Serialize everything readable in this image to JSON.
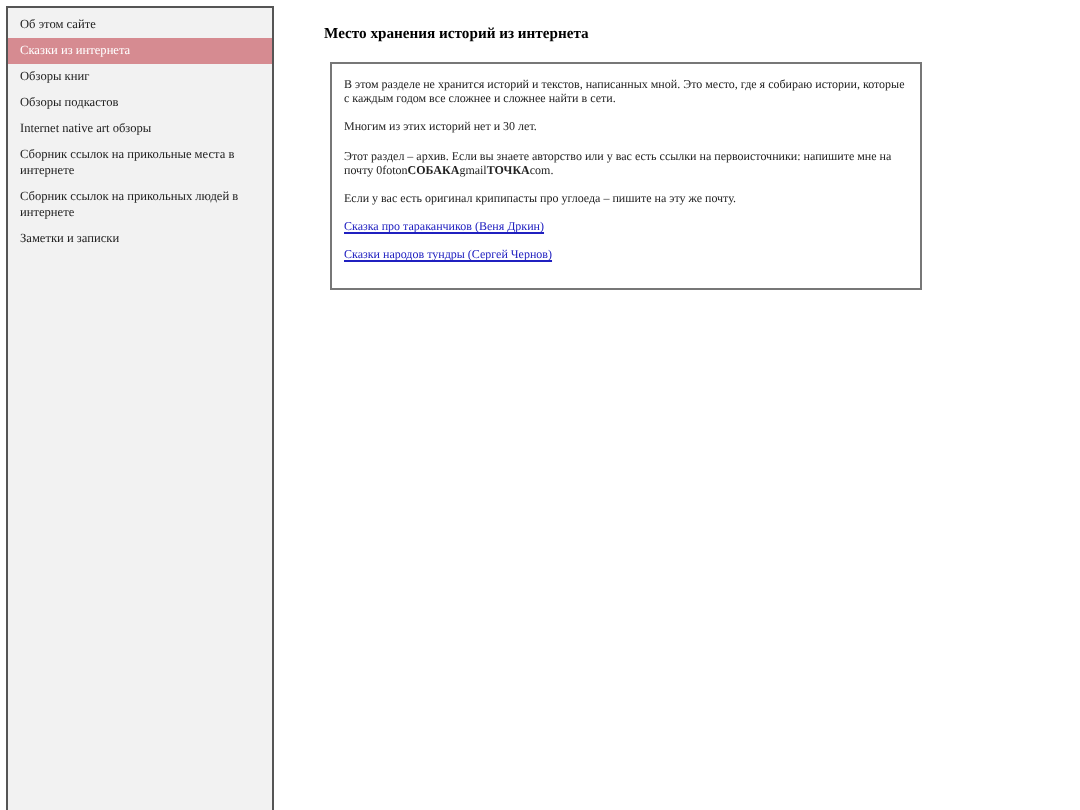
{
  "sidebar": {
    "items": [
      {
        "label": "Об этом сайте",
        "selected": false
      },
      {
        "label": "Сказки из интернета",
        "selected": true
      },
      {
        "label": "Обзоры книг",
        "selected": false
      },
      {
        "label": "Обзоры подкастов",
        "selected": false
      },
      {
        "label": "Internet native art обзоры",
        "selected": false
      },
      {
        "label": "Сборник ссылок на прикольные места в интернете",
        "selected": false
      },
      {
        "label": "Сборник ссылок на прикольных людей в интернете",
        "selected": false
      },
      {
        "label": "Заметки и записки",
        "selected": false
      }
    ]
  },
  "content": {
    "title": "Место хранения историй из интернета",
    "paragraphs": [
      "В этом разделе не хранится историй и текстов, написанных мной. Это место, где я собираю истории, которые с каждым годом все сложнее и сложнее найти в сети.",
      "Многим из этих историй нет и 30 лет.",
      "Этот раздел – архив. Если вы знаете авторство или у вас есть ссылки на первоисточники: напишите мне на почту 0foton**СОБАКА**gmail**ТОЧКА**com.",
      "Если у вас есть оригинал крипипасты про углоеда – пишите на эту же почту."
    ],
    "links": [
      "Сказка про тараканчиков (Веня Дркин)",
      "Сказки народов тундры (Сергей Чернов)"
    ]
  }
}
